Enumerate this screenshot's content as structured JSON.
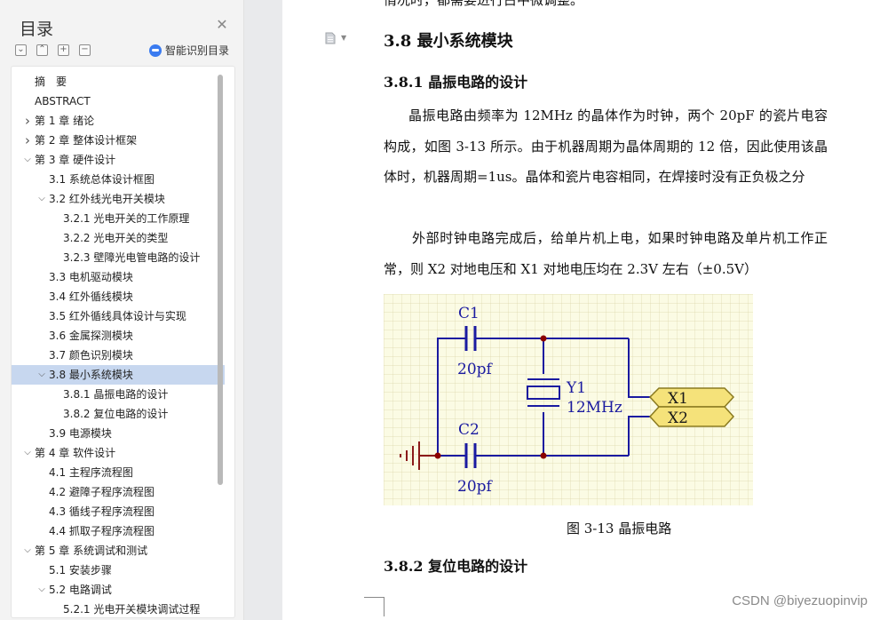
{
  "sidebar": {
    "title": "目录",
    "close_icon": "close-icon",
    "controls": [
      "expand-all-icon",
      "collapse-all-icon",
      "add-icon",
      "remove-icon"
    ],
    "smart_toc_label": "智能识别目录",
    "items": [
      {
        "label": "摘　要",
        "level": 0,
        "chevron": ""
      },
      {
        "label": "ABSTRACT",
        "level": 0,
        "chevron": ""
      },
      {
        "label": "第 1 章  绪论",
        "level": 0,
        "chevron": "right"
      },
      {
        "label": "第 2 章  整体设计框架",
        "level": 0,
        "chevron": "right"
      },
      {
        "label": "第 3 章  硬件设计",
        "level": 0,
        "chevron": "down"
      },
      {
        "label": "3.1  系统总体设计框图",
        "level": 1,
        "chevron": ""
      },
      {
        "label": "3.2  红外线光电开关模块",
        "level": 1,
        "chevron": "down"
      },
      {
        "label": "3.2.1  光电开关的工作原理",
        "level": 2,
        "chevron": ""
      },
      {
        "label": "3.2.2  光电开关的类型",
        "level": 2,
        "chevron": ""
      },
      {
        "label": "3.2.3  壁障光电管电路的设计",
        "level": 2,
        "chevron": ""
      },
      {
        "label": "3.3  电机驱动模块",
        "level": 1,
        "chevron": ""
      },
      {
        "label": "3.4  红外循线模块",
        "level": 1,
        "chevron": ""
      },
      {
        "label": "3.5  红外循线具体设计与实现",
        "level": 1,
        "chevron": ""
      },
      {
        "label": "3.6 金属探测模块",
        "level": 1,
        "chevron": ""
      },
      {
        "label": "3.7  颜色识别模块",
        "level": 1,
        "chevron": ""
      },
      {
        "label": "3.8  最小系统模块",
        "level": 1,
        "chevron": "down",
        "active": true
      },
      {
        "label": "3.8.1  晶振电路的设计",
        "level": 2,
        "chevron": ""
      },
      {
        "label": "3.8.2  复位电路的设计",
        "level": 2,
        "chevron": ""
      },
      {
        "label": "3.9  电源模块",
        "level": 1,
        "chevron": ""
      },
      {
        "label": "第 4 章  软件设计",
        "level": 0,
        "chevron": "down"
      },
      {
        "label": "4.1  主程序流程图",
        "level": 1,
        "chevron": ""
      },
      {
        "label": "4.2  避障子程序流程图",
        "level": 1,
        "chevron": ""
      },
      {
        "label": "4.3  循线子程序流程图",
        "level": 1,
        "chevron": ""
      },
      {
        "label": "4.4 抓取子程序流程图",
        "level": 1,
        "chevron": ""
      },
      {
        "label": "第 5 章  系统调试和测试",
        "level": 0,
        "chevron": "down"
      },
      {
        "label": "5.1  安装步骤",
        "level": 1,
        "chevron": ""
      },
      {
        "label": "5.2  电路调试",
        "level": 1,
        "chevron": "down"
      },
      {
        "label": "5.2.1  光电开关模块调试过程",
        "level": 2,
        "chevron": ""
      }
    ]
  },
  "document": {
    "cut_text": "情况时，都需要进行占中微调整。",
    "heading_3_8": "3.8  最小系统模块",
    "heading_3_8_1": "3.8.1  晶振电路的设计",
    "para1": "晶振电路由频率为 12MHz 的晶体作为时钟，两个 20pF 的瓷片电容构成，如图 3-13 所示。由于机器周期为晶体周期的 12 倍，因此使用该晶体时，机器周期=1us。晶体和瓷片电容相同，在焊接时没有正负极之分",
    "para2": "外部时钟电路完成后，给单片机上电，如果时钟电路及单片机工作正常，则 X2 对地电压和 X1 对地电压均在 2.3V 左右（±0.5V）",
    "figure": {
      "c1_label": "C1",
      "c1_value": "20pf",
      "c2_label": "C2",
      "c2_value": "20pf",
      "y1_label": "Y1",
      "y1_value": "12MHz",
      "x1_label": "X1",
      "x2_label": "X2",
      "grid_color": "#d9d2a3",
      "background": "#fbfbe4",
      "wire_color": "#1a1aa0"
    },
    "caption": "图 3-13  晶振电路",
    "heading_3_8_2": "3.8.2  复位电路的设计",
    "doc_icon": "document-icon"
  },
  "watermark": "CSDN @biyezuopinvip"
}
